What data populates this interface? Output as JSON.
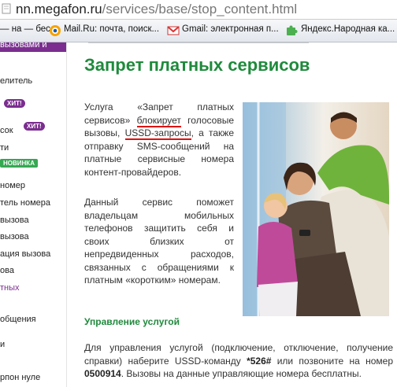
{
  "browser": {
    "url_host": "nn.megafon.ru",
    "url_path": "/services/base/stop_content.html",
    "bookmarks": [
      {
        "label": "— на — бес...",
        "icon": "page-icon"
      },
      {
        "label": "Mail.Ru: почта, поиск...",
        "icon": "mailru-icon"
      },
      {
        "label": "Gmail: электронная п...",
        "icon": "gmail-icon"
      },
      {
        "label": "Яндекс.Народная ка...",
        "icon": "puzzle-icon"
      }
    ]
  },
  "nav": {
    "top_label": "вызовами и",
    "items": [
      {
        "label": "елитель",
        "purple": false
      },
      {
        "label": "сок",
        "purple": false
      },
      {
        "label": "ти",
        "purple": false
      },
      {
        "label": "номер",
        "purple": false
      },
      {
        "label": "тель номера",
        "purple": false
      },
      {
        "label": "вызова",
        "purple": false
      },
      {
        "label": "вызова",
        "purple": false
      },
      {
        "label": "ация вызова",
        "purple": false
      },
      {
        "label": "ова",
        "purple": false
      },
      {
        "label": "тных",
        "purple": true
      },
      {
        "label": "общения",
        "purple": false
      },
      {
        "label": "и",
        "purple": false
      },
      {
        "label": "рпон нуле",
        "purple": false
      }
    ],
    "badges": {
      "hit1": "ХИТ!",
      "hit2": "ХИТ!",
      "new": "НОВИНКА"
    }
  },
  "main": {
    "title": "Запрет платных сервисов",
    "para1_a": "Услуга «Запрет платных сервисов» ",
    "para1_b": "блокирует",
    "para1_c": " голосовые вызовы, ",
    "para1_d": "USSD-запросы",
    "para1_e": ", а также отправку SMS-сообщений на платные сервисные номера контент-провайдеров.",
    "para2": "Данный сервис поможет владельцам мобильных телефонов защитить себя и своих близких от непредвиденных расходов, связанных с обращениями к платным «коротким» номерам.",
    "section_title": "Управление услугой",
    "bottom_a": "Для управления услугой (подключение, отключение, получение справки) наберите USSD-команду ",
    "bottom_code": "*526#",
    "bottom_b": " или позвоните на номер ",
    "bottom_number": "0500914",
    "bottom_c": ". Вызовы на данные управляющие номера бесплатны."
  },
  "colors": {
    "accent_green": "#1f8a3c",
    "brand_purple": "#7b2e8f",
    "underline_red": "#dd1111"
  }
}
